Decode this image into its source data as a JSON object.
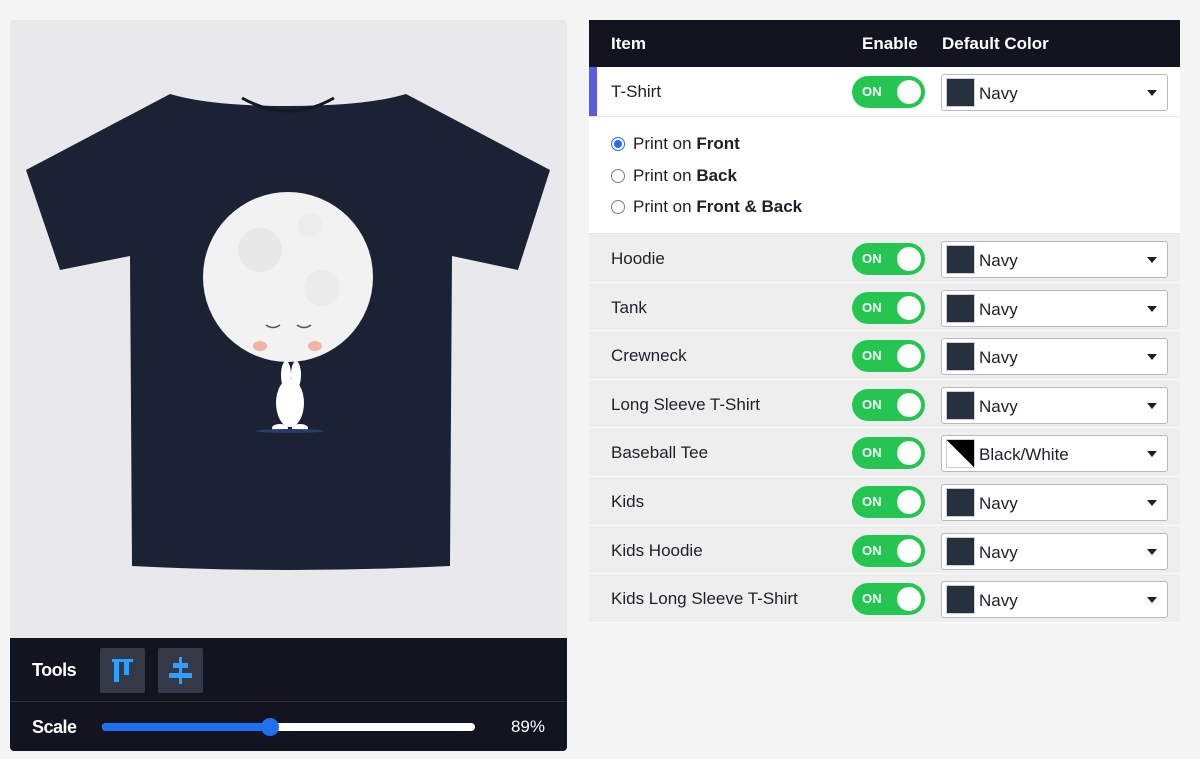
{
  "preview": {
    "shirt_color": "#1a2233",
    "moon_color": "#f2f2f2"
  },
  "tools": {
    "label": "Tools",
    "buttons": [
      {
        "icon": "align-top-icon"
      },
      {
        "icon": "align-center-icon"
      }
    ]
  },
  "scale": {
    "label": "Scale",
    "value_text": "89%",
    "slider_fraction": 0.45
  },
  "table": {
    "headers": {
      "item": "Item",
      "enable": "Enable",
      "default_color": "Default Color"
    },
    "toggle_on_label": "ON",
    "rows": [
      {
        "label": "T-Shirt",
        "color": "Navy",
        "swatch": "#27303f",
        "enabled": true,
        "active": true
      },
      {
        "label": "Hoodie",
        "color": "Navy",
        "swatch": "#27303f",
        "enabled": true
      },
      {
        "label": "Tank",
        "color": "Navy",
        "swatch": "#27303f",
        "enabled": true
      },
      {
        "label": "Crewneck",
        "color": "Navy",
        "swatch": "#27303f",
        "enabled": true
      },
      {
        "label": "Long Sleeve T-Shirt",
        "color": "Navy",
        "swatch": "#27303f",
        "enabled": true
      },
      {
        "label": "Baseball Tee",
        "color": "Black/White",
        "swatch": "split",
        "enabled": true
      },
      {
        "label": "Kids",
        "color": "Navy",
        "swatch": "#27303f",
        "enabled": true
      },
      {
        "label": "Kids Hoodie",
        "color": "Navy",
        "swatch": "#27303f",
        "enabled": true
      },
      {
        "label": "Kids Long Sleeve T-Shirt",
        "color": "Navy",
        "swatch": "#27303f",
        "enabled": true
      }
    ]
  },
  "print_options": [
    {
      "prefix": "Print on ",
      "bold": "Front",
      "checked": true
    },
    {
      "prefix": "Print on ",
      "bold": "Back",
      "checked": false
    },
    {
      "prefix": "Print on ",
      "bold": "Front & Back",
      "checked": false
    }
  ],
  "colors": {
    "header_bg": "#121420",
    "toggle_on": "#24c550",
    "accent_blue": "#1f6ff0",
    "active_marker": "#5b5ce0"
  }
}
